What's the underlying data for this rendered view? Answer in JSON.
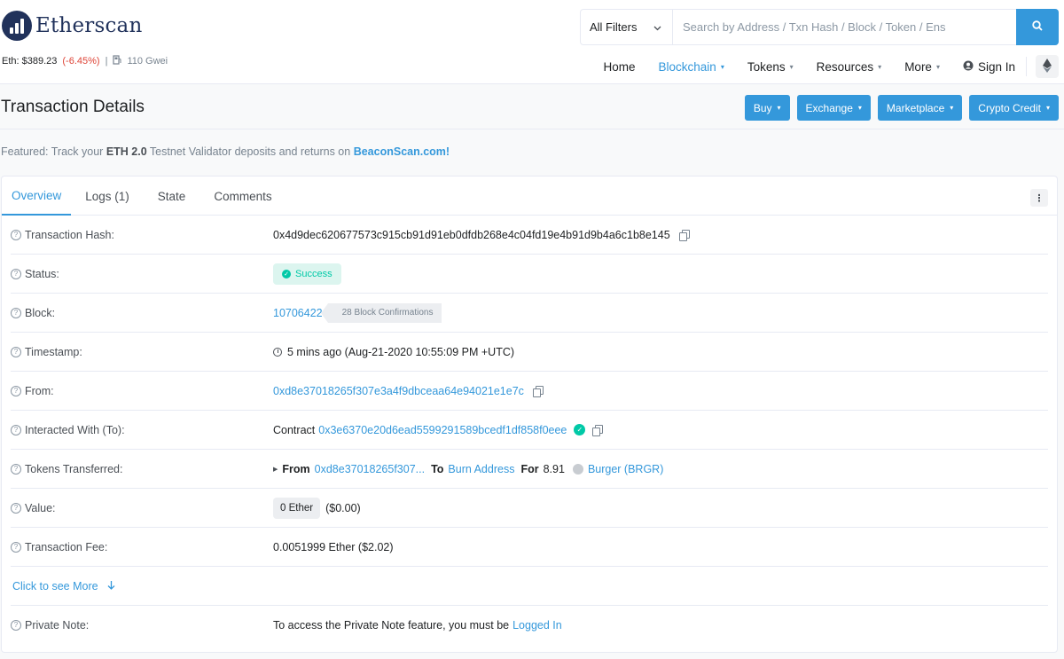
{
  "header": {
    "logo_text": "Etherscan",
    "eth_price_label": "Eth: $389.23",
    "eth_change": "(-6.45%)",
    "separator": "|",
    "gas": "110 Gwei",
    "filter_label": "All Filters",
    "search_placeholder": "Search by Address / Txn Hash / Block / Token / Ens",
    "nav": {
      "home": "Home",
      "blockchain": "Blockchain",
      "tokens": "Tokens",
      "resources": "Resources",
      "more": "More",
      "sign_in": "Sign In"
    }
  },
  "title_bar": {
    "title": "Transaction Details",
    "buttons": {
      "buy": "Buy",
      "exchange": "Exchange",
      "marketplace": "Marketplace",
      "crypto_credit": "Crypto Credit"
    }
  },
  "featured": {
    "prefix": "Featured: Track your",
    "bold": "ETH 2.0",
    "middle": "Testnet Validator deposits and returns on",
    "link": "BeaconScan.com!"
  },
  "tabs": {
    "overview": "Overview",
    "logs": "Logs (1)",
    "state": "State",
    "comments": "Comments",
    "more": "⋮"
  },
  "details": {
    "tx_hash": {
      "label": "Transaction Hash:",
      "value": "0x4d9dec620677573c915cb91d91eb0dfdb268e4c04fd19e4b91d9b4a6c1b8e145"
    },
    "status": {
      "label": "Status:",
      "value": "Success"
    },
    "block": {
      "label": "Block:",
      "value": "10706422",
      "confirmations": "28 Block Confirmations"
    },
    "timestamp": {
      "label": "Timestamp:",
      "value": "5 mins ago (Aug-21-2020 10:55:09 PM +UTC)"
    },
    "from": {
      "label": "From:",
      "value": "0xd8e37018265f307e3a4f9dbceaa64e94021e1e7c"
    },
    "interacted": {
      "label": "Interacted With (To):",
      "prefix": "Contract",
      "value": "0x3e6370e20d6ead5599291589bcedf1df858f0eee"
    },
    "tokens": {
      "label": "Tokens Transferred:",
      "from_word": "From",
      "from_addr": "0xd8e37018265f307...",
      "to_word": "To",
      "to_addr": "Burn Address",
      "for_word": "For",
      "amount": "8.91",
      "token": "Burger (BRGR)"
    },
    "value": {
      "label": "Value:",
      "amount": "0 Ether",
      "usd": "($0.00)"
    },
    "fee": {
      "label": "Transaction Fee:",
      "value": "0.0051999 Ether ($2.02)"
    },
    "more": {
      "label": "Click to see More"
    },
    "private_note": {
      "label": "Private Note:",
      "text": "To access the Private Note feature, you must be",
      "link": "Logged In"
    }
  },
  "colors": {
    "accent": "#3498db",
    "success": "#00c9a7",
    "negative": "#de4437",
    "brand": "#21325b"
  }
}
